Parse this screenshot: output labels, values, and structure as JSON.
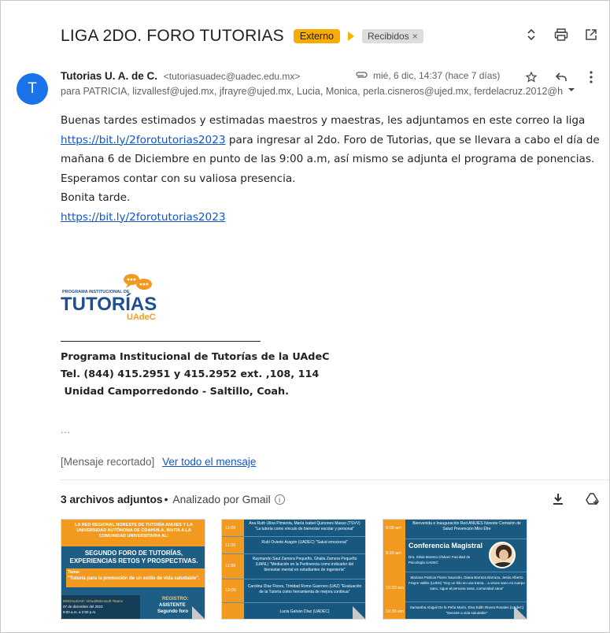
{
  "subject": {
    "title": "LIGA 2DO. FORO TUTORIAS",
    "badge_external": "Externo",
    "badge_inbox": "Recibidos",
    "badge_inbox_close": "×"
  },
  "sender": {
    "avatar_letter": "T",
    "name": "Tutorias U. A. de C.",
    "email": "<tutoriasuadec@uadec.edu.mx>",
    "date": "mié, 6 dic, 14:37 (hace 7 días)",
    "recipients": "para PATRICIA, lizvallesf@ujed.mx, jfrayre@ujed.mx, Lucia, Monica, perla.cisneros@ujed.mx, ferdelacruz.2012@h"
  },
  "body": {
    "line1": "Buenas tardes estimados y estimadas maestros y maestras, les adjuntamos en este correo la liga",
    "link1": "https://bit.ly/2forotutorias2023",
    "line2_after_link": " para ingresar al 2do. Foro de Tutorias, que se llevara a cabo el día de",
    "line3": "mañana 6 de Diciembre en punto de las 9:00 a.m,  así mismo se adjunta el programa de ponencias.",
    "line4": "Esperamos contar con su valiosa presencia.",
    "line5": "Bonita tarde.",
    "link2": "https://bit.ly/2forotutorias2023"
  },
  "logo": {
    "small": "PROGRAMA INSTITUCIONAL DE",
    "big": "TUTORÍAS",
    "sub": "UAdeC"
  },
  "signature": {
    "line1": "Programa Institucional de Tutorías de la UAdeC",
    "line2": "Tel. (844) 415.2951 y 415.2952 ext. ,108, 114",
    "line3": " Unidad Camporredondo - Saltillo, Coah."
  },
  "ellipsis": "...",
  "clipped": {
    "text": "[Mensaje recortado]",
    "link": "Ver todo el mensaje"
  },
  "attachments": {
    "count_label": "3 archivos adjuntos",
    "separator": "•",
    "scanned": "Analizado por Gmail",
    "info": "i",
    "thumb1": {
      "header": "LA RED REGIONAL NORESTE DE TUTORÍA ANUIES Y LA UNIVERSIDAD AUTÓNOMA DE COAHUILA, INVITA A LA COMUNIDAD UNIVERSITARIA AL:",
      "title": "SEGUNDO FORO DE TUTORÍAS, EXPERIENCIAS RETOS Y PROSPECTIVAS.",
      "tema_label": "Tema:",
      "tema": "\"Tutoría para la promoción de un estilo de vida saludable\".",
      "modalidad": "MODALIDAD: Virtual/Microsoft Teams",
      "fecha": "07 de diciembre del 2023",
      "hora": "9:00 a.m. a 2:00 p.m.",
      "registro": "REGISTRO:",
      "asistente": "ASISTENTE",
      "foro": "Segundo foro"
    },
    "thumb2": {
      "rows": [
        {
          "time": "11:00",
          "text": "Ana Ruth Ulloa Pimienta, María Isabel Quinones Masso (TSVV) \"La tutoría como vínculo de bienestar escolar y personal\""
        },
        {
          "time": "11:20",
          "text": "Rubí Oviedo Aragón (UADEC) \"Salud emocional\""
        },
        {
          "time": "11:50",
          "text": "Raymundo Saul Zamora Pequeño, Ghalia Zamora Pequeño (UANL) \"Mediación en la Pertinencia como indicador del bienestar mental en estudiantes de ingeniería\""
        },
        {
          "time": "12:05",
          "text": "Carolina Díaz Flores, Trinidad Romo Guerrero (UAZ) \"Evaluación de la Tutoría como herramienta de mejora continua\""
        },
        {
          "time": "",
          "text": "Lucia Galván Díaz (UADEC)"
        }
      ]
    },
    "thumb3": {
      "r1_time": "9:00 am",
      "r1": "Bienvenida e Inauguración Red ANUIES Noreste Comisión de Salud Prevención Mtro Éfre",
      "r2_time": "9:20 am",
      "conf": "Conferencia Magistral",
      "conf_sub": "Dra. Silvia Moreno Chávez Facultad de Psicología UADEC",
      "r3": "Mariana Patricia Flores Saucedo, Diana Barraza Barraza, Jesús Alberto Frayre Vallés (UJED) \"Doy un hilo en una trama... a veces sano mi cuerpo sano, sigue al persona sana, comunidad sana\"",
      "r3_time": "10:20 am",
      "r4_time": "10:35 am",
      "r4": "Samantha Abigail De la Peña Marín, Elsa Edith Rivera Rosales (UAdeC) \"Decarte a vida saludable\""
    }
  },
  "colors": {
    "accent_badge": "#f9ab00",
    "link": "#1155cc",
    "avatar": "#1a73e8",
    "thumb_navy": "#1e5e84",
    "thumb_orange": "#f29a1f"
  },
  "icons": [
    "expand-collapse-icon",
    "print-icon",
    "open-new-window-icon",
    "paperclip-icon",
    "star-icon",
    "reply-icon",
    "more-vert-icon",
    "dropdown-caret-icon",
    "info-icon",
    "download-icon",
    "add-to-drive-icon"
  ]
}
